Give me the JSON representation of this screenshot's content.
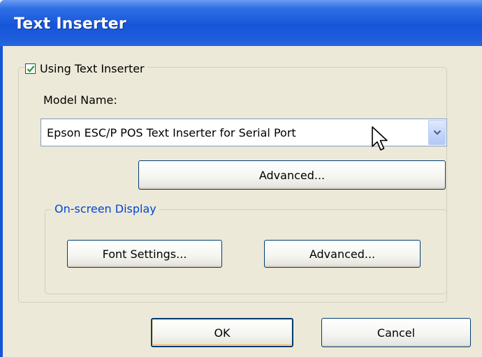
{
  "window": {
    "title": "Text Inserter"
  },
  "using_checkbox": {
    "label": "Using Text Inserter",
    "checked": true
  },
  "model": {
    "label": "Model Name:",
    "selected": "Epson ESC/P POS Text Inserter for Serial Port"
  },
  "advanced_main": {
    "label": "Advanced..."
  },
  "osd": {
    "group_label": "On-screen Display",
    "font_settings_label": "Font Settings...",
    "advanced_label": "Advanced..."
  },
  "footer": {
    "ok_label": "OK",
    "cancel_label": "Cancel"
  },
  "colors": {
    "titlebar": "#1655d8",
    "client_bg": "#ece9d8",
    "group_label": "#0046d5",
    "check": "#21a121"
  },
  "icons": {
    "checkbox": "check-icon",
    "dropdown": "chevron-down-icon",
    "cursor": "mouse-pointer-icon"
  }
}
